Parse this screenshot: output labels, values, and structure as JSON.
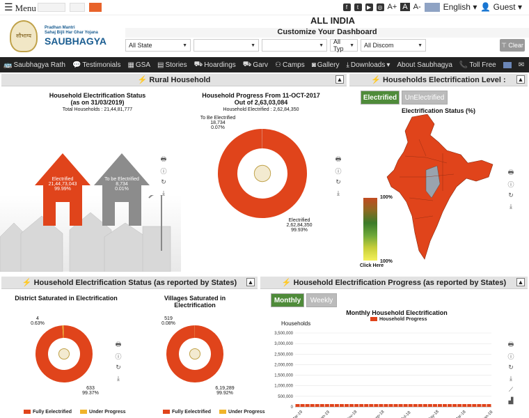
{
  "topbar": {
    "menu_label": "Menu",
    "logos": [
      "MINISTRY OF POWER",
      "सौभाग्य",
      "REC"
    ],
    "font_small": "A-",
    "font_mid": "A",
    "font_big": "A+",
    "language": "English",
    "user": "Guest"
  },
  "header": {
    "logo_line1": "Pradhan Mantri",
    "logo_line2": "Sahaj Bijli Har Ghar Yojana",
    "logo_hindi": "सौभाग्य",
    "logo_name": "SAUBHAGYA",
    "region_title": "ALL INDIA",
    "customize_title": "Customize Your Dashboard",
    "filters": [
      "All State",
      "",
      "",
      "All Typ",
      "All Discom"
    ],
    "clear_label": "Clear"
  },
  "nav": [
    "Saubhagya Rath",
    "Testimonials",
    "GSA",
    "Stories",
    "Hoardings",
    "Garv",
    "Camps",
    "Gallery",
    "Downloads",
    "About Saubhagya",
    "Toll Free"
  ],
  "panels": {
    "rural": "Rural Household",
    "electrification_level": "Households Electrification Level :",
    "status_by_states": "Household Electrification Status (as reported by States)",
    "progress_by_states": "Household Electrification Progress (as reported by States)"
  },
  "rural": {
    "status_title_1": "Household Electrification Status",
    "status_title_2": "(as on 31/03/2019)",
    "total_households": "Total  Households : 21,44,81,777",
    "electrified_label": "Electrified",
    "electrified_value": "21,44,73,043",
    "electrified_pct": "99.99%",
    "tobe_label": "To be Electrified",
    "tobe_value": "8,734",
    "tobe_pct": "0.01%",
    "progress_title_1": "Household Progress From 11-OCT-2017",
    "progress_title_2": "Out of 2,63,03,084",
    "household_electrified": "Household Electrified : 2,62,84,350",
    "donut_tobe_label": "To Be Electrified",
    "donut_tobe_value": "18,734",
    "donut_tobe_pct": "0.07%",
    "donut_elec_label": "Electrified",
    "donut_elec_value": "2,62,84,350",
    "donut_elec_pct": "99.93%"
  },
  "level": {
    "tab_on": "Electrified",
    "tab_off": "UnElectrified",
    "map_title": "Electrification Status (%)",
    "scale_top": "100%",
    "scale_bottom": "100%",
    "click_here": "Click Here"
  },
  "district": {
    "title": "District Saturated in Electrification",
    "small_value": "4",
    "small_pct": "0.63%",
    "big_value": "633",
    "big_pct": "99.37%"
  },
  "villages": {
    "title": "Villages Saturated in Electrification",
    "small_value": "519",
    "small_pct": "0.08%",
    "big_value": "6,19,289",
    "big_pct": "99.92%"
  },
  "legend": {
    "fully": "Fully Eelectrified",
    "progress": "Under Progress"
  },
  "progress": {
    "tab_on": "Monthly",
    "tab_off": "Weekly",
    "chart_title": "Monthly Household Electrification",
    "series_name": "Household Progress",
    "y_axis": "Households"
  },
  "colors": {
    "accent": "#e0441b",
    "yellow": "#f0b429",
    "green": "#4f8b3a",
    "nav": "#222222"
  },
  "chart_data": [
    {
      "type": "pie",
      "title": "Household Progress From 11-OCT-2017",
      "categories": [
        "Electrified",
        "To Be Electrified"
      ],
      "values": [
        26284350,
        18734
      ],
      "colors": [
        "#e0441b",
        "#c9c9c9"
      ]
    },
    {
      "type": "pie",
      "title": "District Saturated in Electrification",
      "categories": [
        "Fully Eelectrified",
        "Under Progress"
      ],
      "values": [
        633,
        4
      ],
      "colors": [
        "#e0441b",
        "#f0b429"
      ]
    },
    {
      "type": "pie",
      "title": "Villages Saturated in Electrification",
      "categories": [
        "Fully Eelectrified",
        "Under Progress"
      ],
      "values": [
        619289,
        519
      ],
      "colors": [
        "#e0441b",
        "#f0b429"
      ]
    },
    {
      "type": "bar",
      "title": "Monthly Household Electrification",
      "x": [
        "Mar-19",
        "Jan-19",
        "Nov-18",
        "Sep-18",
        "Jul-18",
        "May-18",
        "Mar-18",
        "Jan-18"
      ],
      "series": [
        {
          "name": "Household Progress",
          "values": [
            0,
            0,
            0,
            0,
            0,
            0,
            0,
            0
          ]
        }
      ],
      "ylabel": "Households",
      "yticks": [
        "0",
        "500,000",
        "1,000,000",
        "1,500,000",
        "2,000,000",
        "2,500,000",
        "3,000,000",
        "3,500,000"
      ],
      "ylim": [
        0,
        3500000
      ]
    }
  ]
}
